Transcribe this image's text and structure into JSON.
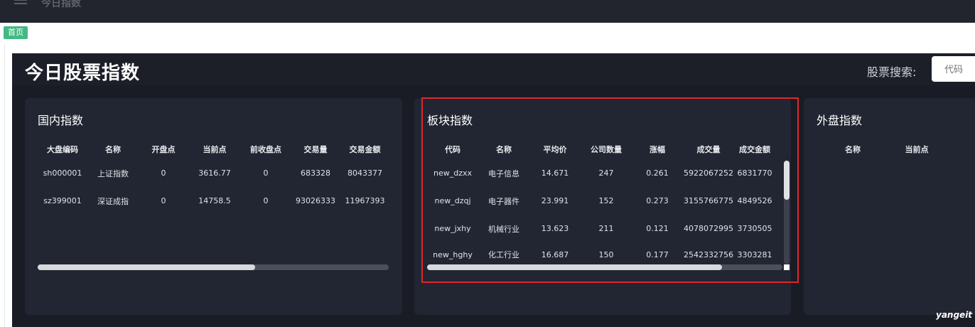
{
  "topbar": {
    "title": "今日指数"
  },
  "tabs": [
    {
      "label": "首页"
    }
  ],
  "dashboard": {
    "title": "今日股票指数",
    "search": {
      "label": "股票搜索:",
      "placeholder": "代码"
    }
  },
  "domestic": {
    "title": "国内指数",
    "columns": [
      "大盘编码",
      "名称",
      "开盘点",
      "当前点",
      "前收盘点",
      "交易量",
      "交易金额"
    ],
    "rows": [
      [
        "sh000001",
        "上证指数",
        "0",
        "3616.77",
        "0",
        "683328",
        "8043377"
      ],
      [
        "sz399001",
        "深证成指",
        "0",
        "14758.5",
        "0",
        "93026333",
        "11967393"
      ]
    ],
    "scroll_position": 0.62
  },
  "sector": {
    "title": "板块指数",
    "columns": [
      "代码",
      "名称",
      "平均价",
      "公司数量",
      "涨幅",
      "成交量",
      "成交金额"
    ],
    "rows": [
      [
        "new_dzxx",
        "电子信息",
        "14.671",
        "247",
        "0.261",
        "5922067252",
        "6831770"
      ],
      [
        "new_dzqj",
        "电子器件",
        "23.991",
        "152",
        "0.273",
        "3155766775",
        "4849526"
      ],
      [
        "new_jxhy",
        "机械行业",
        "13.623",
        "211",
        "0.121",
        "4078072995",
        "3730505"
      ],
      [
        "new_hghy",
        "化工行业",
        "16.687",
        "150",
        "0.177",
        "2542332756",
        "3303281"
      ]
    ],
    "scroll_position": 0.83
  },
  "foreign": {
    "title": "外盘指数",
    "columns": [
      "名称",
      "当前点"
    ]
  },
  "watermark": "yangeit",
  "colors": {
    "highlight": "#e0262b",
    "tag": "#42b983",
    "panel": "#222632",
    "background": "#191c25"
  }
}
